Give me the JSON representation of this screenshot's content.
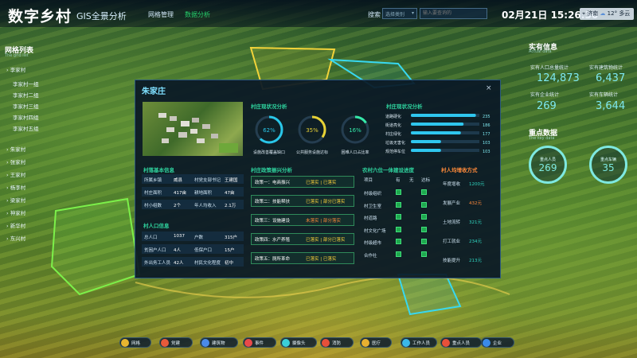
{
  "header": {
    "title": "数字乡村",
    "subtitle": "GIS全景分析",
    "nav": [
      "网格管理",
      "数据分析"
    ],
    "search_label": "搜索",
    "search_select": "选择类别",
    "search_placeholder": "输入要查询的",
    "datetime": "02月21日 15:26:30",
    "weather_city": "济南",
    "weather_temp": "12°",
    "weather_cond": "多云"
  },
  "grid_list": {
    "title": "网格列表",
    "subtitle": "The grid list",
    "items": [
      "李家村",
      "李家村一组",
      "李家村二组",
      "李家村三组",
      "李家村四组",
      "李家村五组",
      "朱家村",
      "张家村",
      "王家村",
      "杨李村",
      "梁家村",
      "神家村",
      "新华村",
      "东兴村"
    ]
  },
  "real_stats": {
    "title": "实有信息",
    "subtitle": "Actual data",
    "items": [
      {
        "label": "实有人口总量统计",
        "value": "124,873"
      },
      {
        "label": "实有建筑物统计",
        "value": "6,437"
      },
      {
        "label": "实有企业统计",
        "value": "269"
      },
      {
        "label": "实有车辆统计",
        "value": "3,644"
      }
    ]
  },
  "key_data": {
    "title": "重点数据",
    "subtitle": "The key data",
    "circles": [
      {
        "label": "重点人员",
        "value": "269"
      },
      {
        "label": "重点车辆",
        "value": "35"
      }
    ]
  },
  "modal": {
    "title": "朱家庄",
    "close": "×",
    "village_status": {
      "title": "村庄现状况分析",
      "gauges": [
        {
          "label": "设施改善覆盖缺口",
          "value": "62%",
          "percent": 62,
          "color": "#29c6e8"
        },
        {
          "label": "公共服务设施达标",
          "value": "35%",
          "percent": 35,
          "color": "#e8d235"
        },
        {
          "label": "困难人口占比率",
          "value": "16%",
          "percent": 16,
          "color": "#35e8a8"
        }
      ]
    },
    "village_bars": {
      "title": "村庄现状况分析",
      "bars": [
        {
          "label": "道路硬化",
          "value": "235",
          "percent": 95
        },
        {
          "label": "街道亮化",
          "value": "186",
          "percent": 77
        },
        {
          "label": "村庄绿化",
          "value": "177",
          "percent": 73
        },
        {
          "label": "垃圾无害化",
          "value": "103",
          "percent": 44
        },
        {
          "label": "规范停车位",
          "value": "103",
          "percent": 44
        }
      ]
    },
    "basic_info": {
      "title": "村落基本信息",
      "rows": [
        [
          "所属乡镇",
          "威县",
          "村党支部书记",
          "王建国"
        ],
        [
          "村庄面积",
          "417亩",
          "耕地面积",
          "47亩"
        ],
        [
          "村小组数",
          "2个",
          "年人均收入",
          "2.1万"
        ]
      ]
    },
    "population": {
      "title": "村人口信息",
      "rows": [
        [
          "总人口",
          "1037",
          "户数",
          "315户"
        ],
        [
          "贫困户人口",
          "4人",
          "低保户口",
          "15户"
        ],
        [
          "外出务工人员",
          "42人",
          "村民文化程度",
          "初中"
        ]
      ]
    },
    "policy": {
      "title": "村庄政策振兴分析",
      "items": [
        {
          "label": "政策一：电商振兴",
          "status": "已落实 | 已落实"
        },
        {
          "label": "政策二：技能帮扶",
          "status": "已落实 | 部分已落实"
        },
        {
          "label": "政策三：设施建设",
          "status": "未落实 | 部分落实"
        },
        {
          "label": "政策四：水产养殖",
          "status": "已落实 | 部分已落实"
        },
        {
          "label": "政策五：厕所革命",
          "status": "已落实 | 已落实"
        }
      ]
    },
    "construction": {
      "title": "农村六位一体建设进度",
      "headers": [
        "项目",
        "有",
        "无",
        "达标"
      ],
      "rows": [
        "村级组织",
        "村卫生室",
        "村道路",
        "村文化广场",
        "村级超市",
        "合作社"
      ]
    },
    "income": {
      "title": "村人均增收方式",
      "items": [
        {
          "label": "年度增收",
          "value": "1200元"
        },
        {
          "label": "发展产业",
          "value": "432元"
        },
        {
          "label": "土地流转",
          "value": "321元"
        },
        {
          "label": "打工就业",
          "value": "234元"
        },
        {
          "label": "技能提升",
          "value": "213元"
        }
      ]
    }
  },
  "toolbar": [
    {
      "label": "网格",
      "color": "#e8b630"
    },
    {
      "label": "党建",
      "color": "#e85a3a"
    },
    {
      "label": "建筑物",
      "color": "#4a8ae8"
    },
    {
      "label": "事件",
      "color": "#e84a4a"
    },
    {
      "label": "摄像头",
      "color": "#3acfd8"
    },
    {
      "label": "消防",
      "color": "#e8503a"
    },
    {
      "label": "医疗",
      "color": "#e8b030"
    },
    {
      "label": "工作人员",
      "color": "#3ab8e8"
    },
    {
      "label": "重点人员",
      "color": "#e8503a"
    },
    {
      "label": "企业",
      "color": "#3a8ae8"
    }
  ]
}
